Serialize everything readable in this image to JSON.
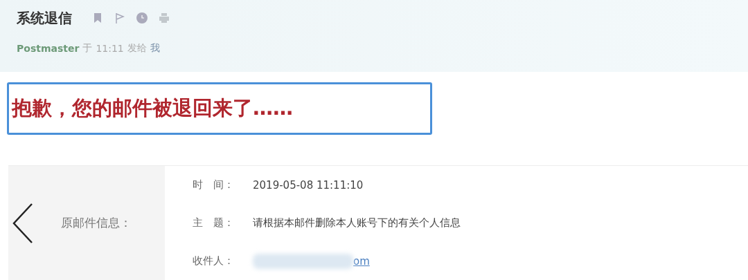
{
  "header": {
    "title": "系统退信",
    "meta": {
      "sender": "Postmaster",
      "at": "于",
      "time": "11:11",
      "sent_to": "发给",
      "recipient": "我"
    }
  },
  "notice": "抱歉，您的邮件被退回来了……",
  "original_info": {
    "label": "原邮件信息：",
    "rows": [
      {
        "label": "时　间：",
        "value": "2019-05-08 11:11:10",
        "kind": "text"
      },
      {
        "label": "主　题：",
        "value": "请根据本邮件删除本人账号下的有关个人信息",
        "kind": "text"
      },
      {
        "label": "收件人：",
        "value": "om",
        "kind": "redacted-link"
      }
    ]
  }
}
